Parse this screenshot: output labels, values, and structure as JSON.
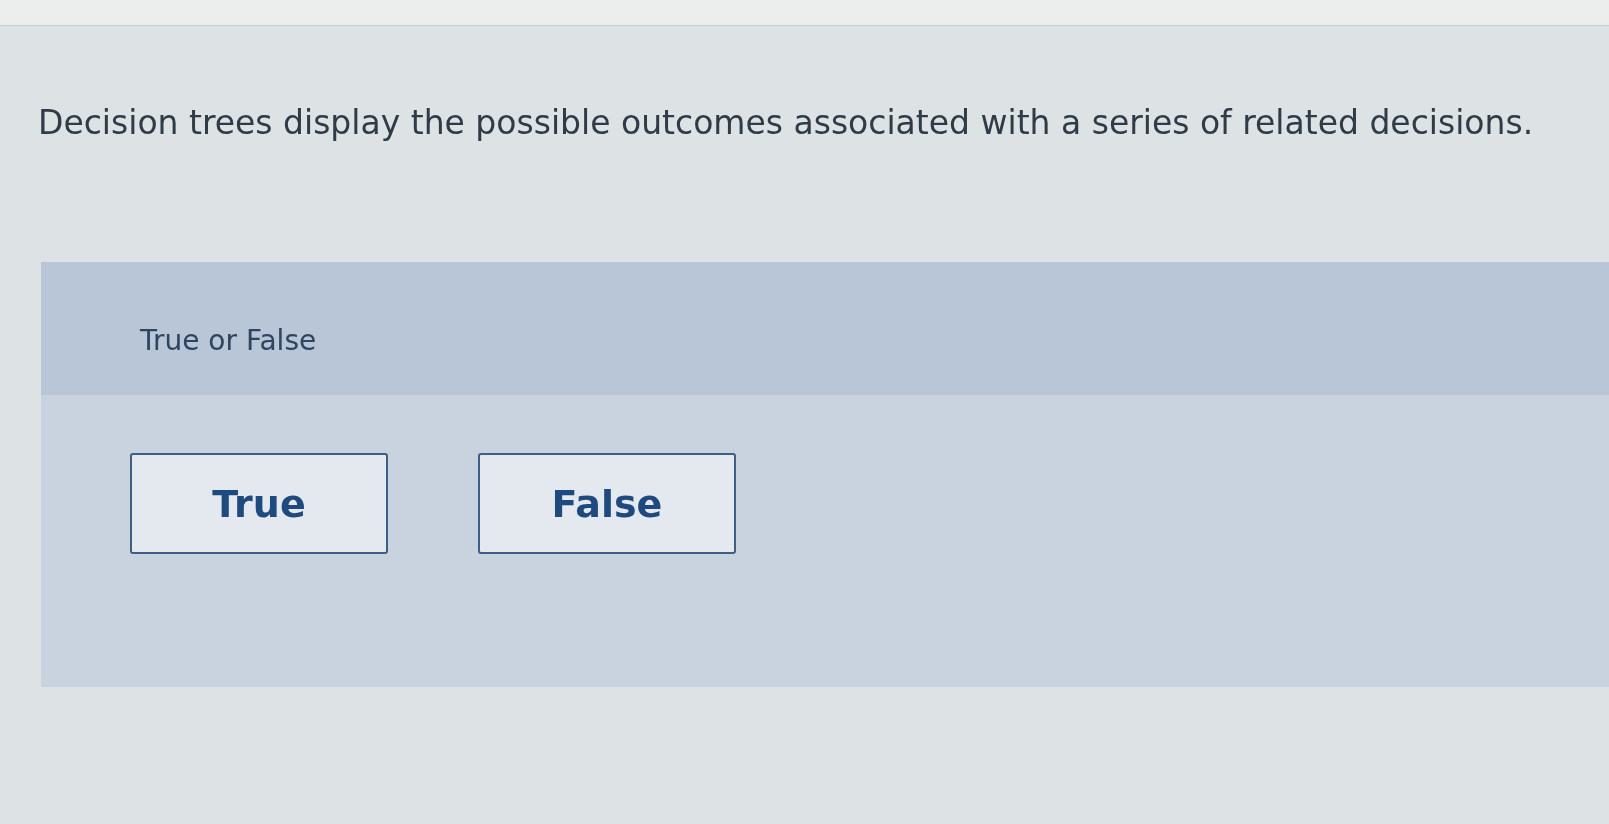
{
  "question": {
    "statement": "Decision trees display the possible outcomes associated with a series of related decisions."
  },
  "answer_panel": {
    "prompt": "True or False",
    "options": [
      {
        "label": "True",
        "selected": false
      },
      {
        "label": "False",
        "selected": false
      }
    ]
  }
}
